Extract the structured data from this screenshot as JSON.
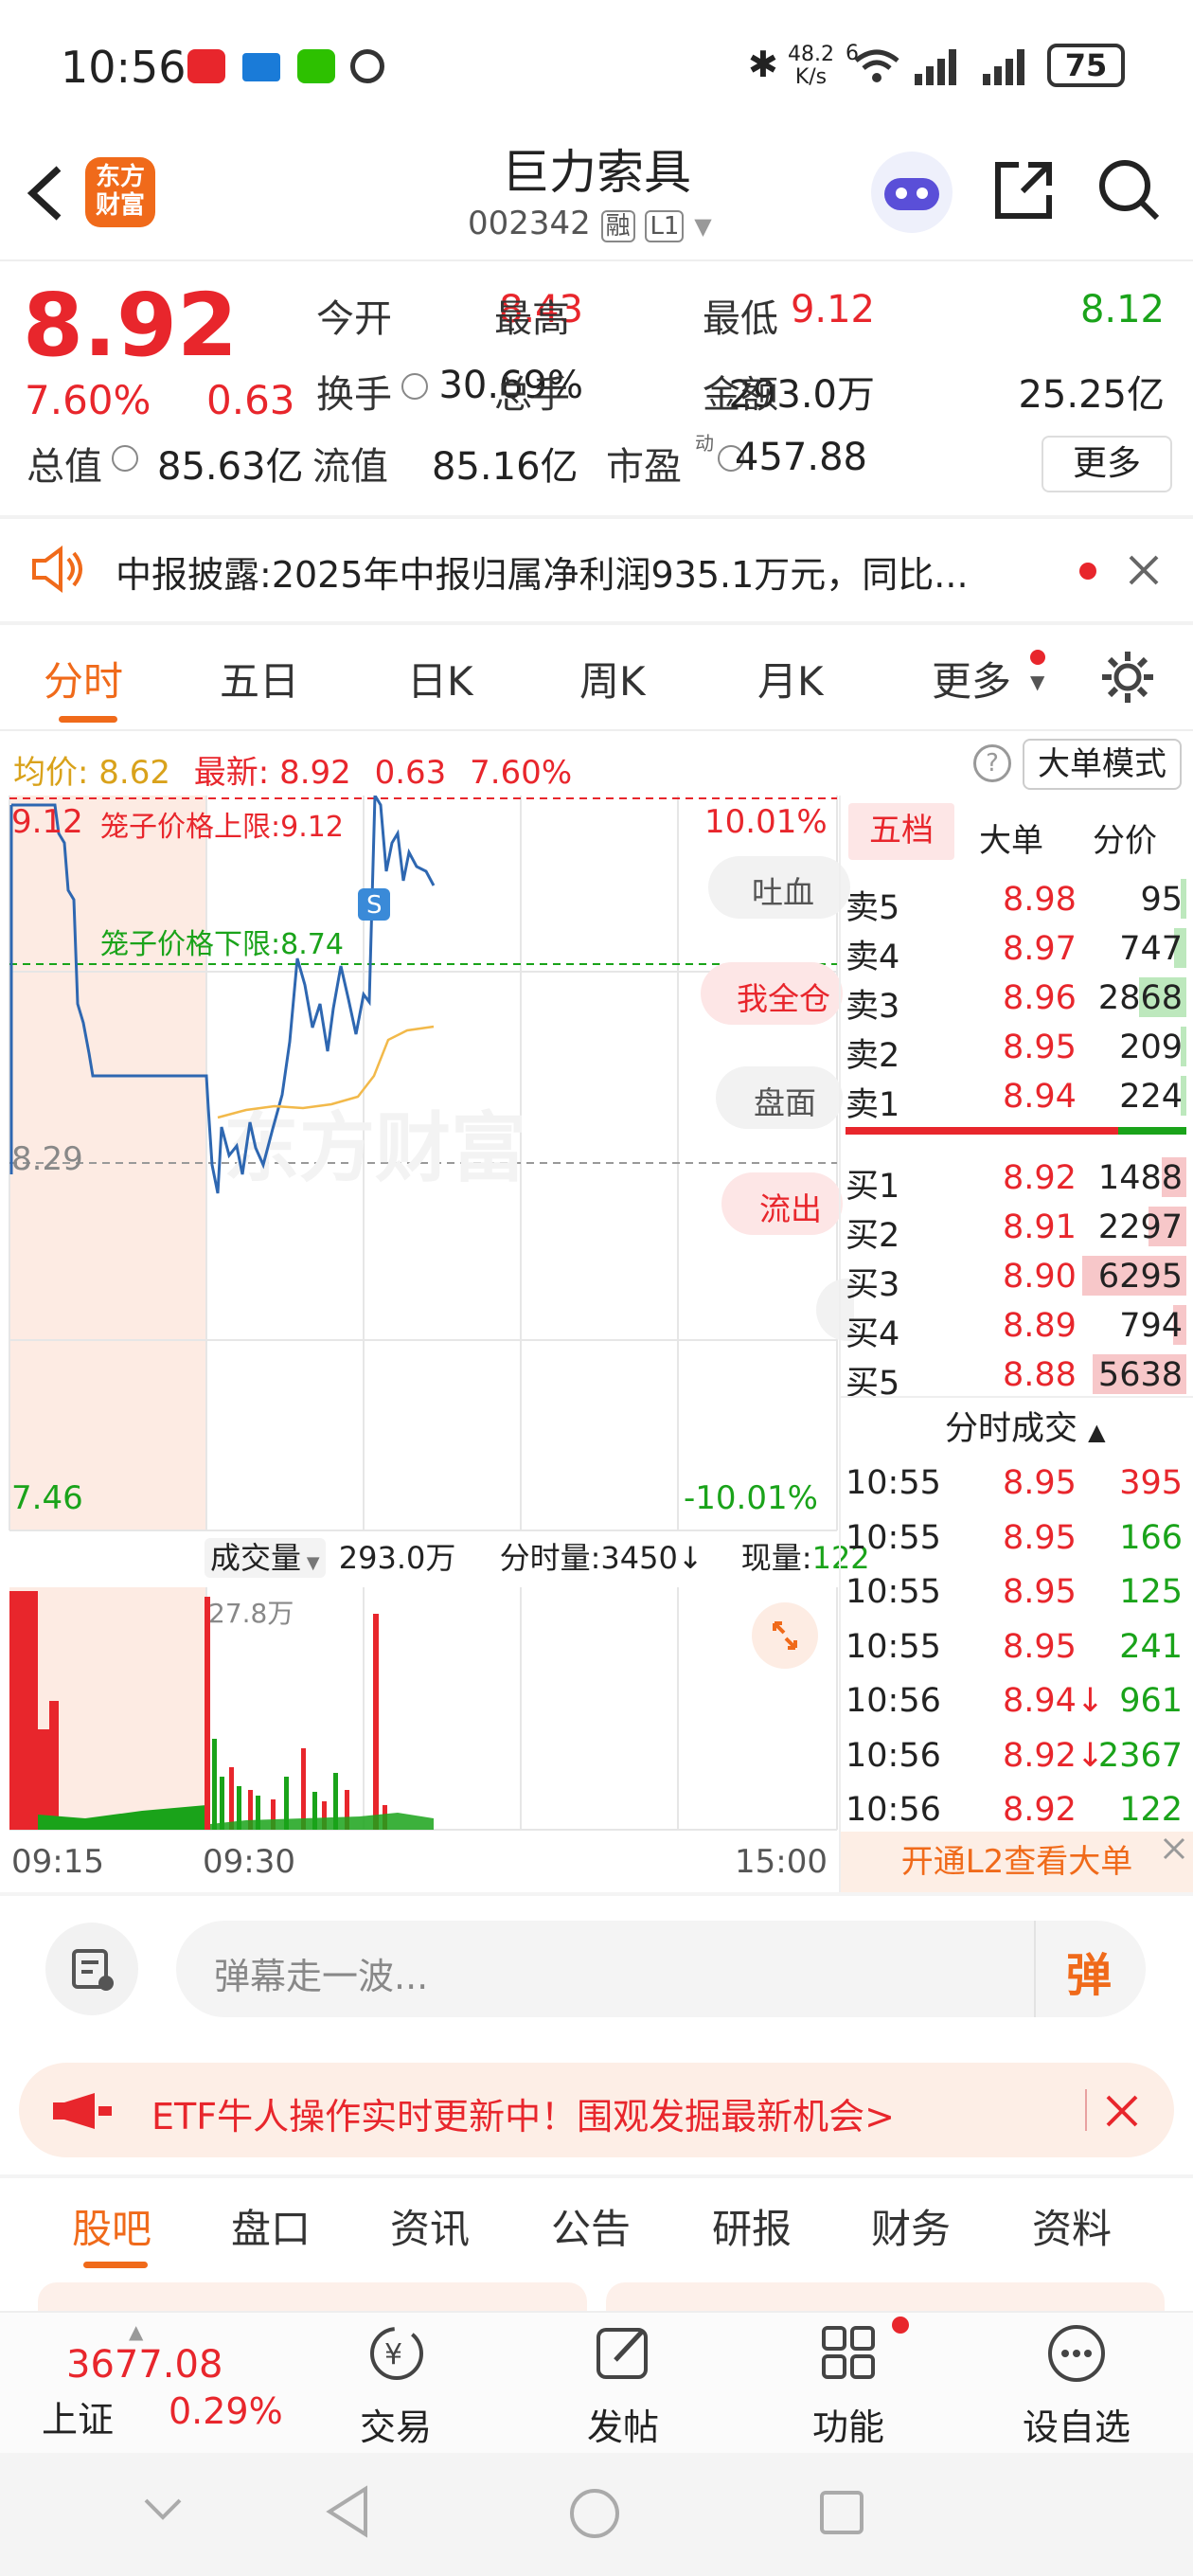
{
  "status": {
    "time": "10:56",
    "net_speed": "48.2",
    "net_unit": "K/s",
    "battery": "75",
    "net_mark": "6"
  },
  "header": {
    "name": "巨力索具",
    "code": "002342",
    "tag1": "融",
    "tag2": "L1",
    "logo_line1": "东方",
    "logo_line2": "财富"
  },
  "quote": {
    "price": "8.92",
    "pct": "7.60%",
    "chg": "0.63",
    "r1": [
      {
        "k": "今开",
        "v": "8.43",
        "c": "red"
      },
      {
        "k": "最高",
        "v": "9.12",
        "c": "red"
      },
      {
        "k": "最低",
        "v": "8.12",
        "c": "green"
      }
    ],
    "r2": [
      {
        "k": "换手",
        "v": "30.69%"
      },
      {
        "k": "总手",
        "v": "293.0万"
      },
      {
        "k": "金额",
        "v": "25.25亿"
      }
    ],
    "r3": [
      {
        "k": "总值",
        "v": "85.63亿"
      },
      {
        "k": "流值",
        "v": "85.16亿"
      },
      {
        "k": "市盈",
        "v": "457.88",
        "sup": "动"
      }
    ],
    "more": "更多"
  },
  "notice": {
    "label": "中报披露:",
    "text": "2025年中报归属净利润935.1万元，同比..."
  },
  "tabs": [
    "分时",
    "五日",
    "日K",
    "周K",
    "月K",
    "更多"
  ],
  "avg": {
    "avg_label": "均价:",
    "avg": "8.62",
    "last_label": "最新:",
    "last": "8.92",
    "chg": "0.63",
    "pct": "7.60%",
    "mode": "大单模式"
  },
  "chart": {
    "ymax": "9.12",
    "ymid": "8.29",
    "ymin": "7.46",
    "pct_top": "10.01%",
    "pct_bottom": "-10.01%",
    "upper_label": "笼子价格上限:",
    "upper": "9.12",
    "lower_label": "笼子价格下限:",
    "lower": "8.74",
    "s_badge": "S",
    "watermark": "东方财富"
  },
  "danmaku_pills": [
    "吐血",
    "我全仓",
    "盘面才",
    "流出"
  ],
  "volume": {
    "label": "成交量",
    "total": "293.0万",
    "fs_label": "分时量:",
    "fs": "3450",
    "now_label": "现量:",
    "now": "122",
    "peak": "27.8万"
  },
  "times": [
    "09:15",
    "09:30",
    "15:00"
  ],
  "orderbook": {
    "tabs": [
      "五档",
      "大单",
      "分价"
    ],
    "asks": [
      {
        "l": "卖5",
        "p": "8.98",
        "v": "95"
      },
      {
        "l": "卖4",
        "p": "8.97",
        "v": "747"
      },
      {
        "l": "卖3",
        "p": "8.96",
        "v": "2868"
      },
      {
        "l": "卖2",
        "p": "8.95",
        "v": "209"
      },
      {
        "l": "卖1",
        "p": "8.94",
        "v": "224"
      }
    ],
    "bids": [
      {
        "l": "买1",
        "p": "8.92",
        "v": "1488"
      },
      {
        "l": "买2",
        "p": "8.91",
        "v": "2297"
      },
      {
        "l": "买3",
        "p": "8.90",
        "v": "6295"
      },
      {
        "l": "买4",
        "p": "8.89",
        "v": "794"
      },
      {
        "l": "买5",
        "p": "8.88",
        "v": "5638"
      }
    ]
  },
  "ticks_title": "分时成交",
  "ticks": [
    {
      "t": "10:55",
      "p": "8.95",
      "v": "395",
      "c": "red"
    },
    {
      "t": "10:55",
      "p": "8.95",
      "v": "166",
      "c": "green"
    },
    {
      "t": "10:55",
      "p": "8.95",
      "v": "125",
      "c": "green"
    },
    {
      "t": "10:55",
      "p": "8.95",
      "v": "241",
      "c": "green"
    },
    {
      "t": "10:56",
      "p": "8.94↓",
      "v": "961",
      "c": "green"
    },
    {
      "t": "10:56",
      "p": "8.92↓",
      "v": "2367",
      "c": "green"
    },
    {
      "t": "10:56",
      "p": "8.92",
      "v": "122",
      "c": "green"
    }
  ],
  "l2_banner": "开通L2查看大单",
  "danmaku_input": "弹幕走一波...",
  "danmaku_btn": "弹",
  "etf_banner": "ETF牛人操作实时更新中！围观发掘最新机会>",
  "bottom_tabs": [
    "股吧",
    "盘口",
    "资讯",
    "公告",
    "研报",
    "财务",
    "资料"
  ],
  "index": {
    "value": "3677.08",
    "name": "上证",
    "pct": "0.29%"
  },
  "nav": [
    "交易",
    "发帖",
    "功能",
    "设自选"
  ],
  "colors": {
    "red": "#e8262c",
    "green": "#1aa31a",
    "orange": "#f06a1a",
    "gold": "#d9a21b"
  },
  "icons": [
    "back-icon",
    "robot-icon",
    "share-icon",
    "search-icon",
    "speaker-icon",
    "close-icon",
    "gear-icon",
    "help-icon",
    "expand-icon",
    "danmaku-settings-icon",
    "megaphone-icon",
    "trade-icon",
    "post-icon",
    "function-icon",
    "watchlist-icon"
  ]
}
